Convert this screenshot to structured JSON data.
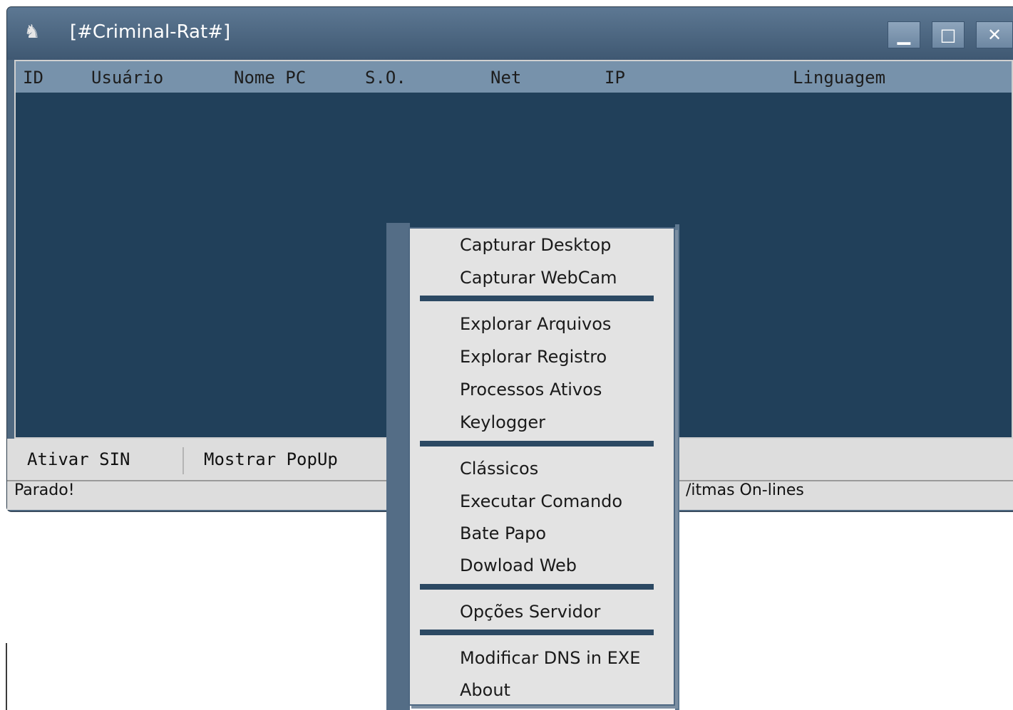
{
  "window": {
    "title": "[#Criminal-Rat#]"
  },
  "columns": [
    "ID",
    "Usuário",
    "Nome PC",
    "S.O.",
    "Net",
    "IP",
    "Linguagem"
  ],
  "toolbar": {
    "ativar_sin": "Ativar SIN",
    "mostrar_popup": "Mostrar PopUp"
  },
  "status": {
    "left": "Parado!",
    "right": "/itmas On-lines"
  },
  "menu": {
    "items": [
      "Capturar Desktop",
      "Capturar WebCam",
      "Explorar Arquivos",
      "Explorar Registro",
      "Processos Ativos",
      "Keylogger",
      "Clássicos",
      "Executar Comando",
      "Bate Papo",
      "Dowload Web",
      "Opções Servidor",
      "Modificar DNS in EXE",
      "About"
    ]
  },
  "colors": {
    "title_bar": "#4f6880",
    "list_bg": "#21405a",
    "header_bg": "#7792ab",
    "menu_bg": "#e3e3e3",
    "separator": "#2c4963"
  }
}
